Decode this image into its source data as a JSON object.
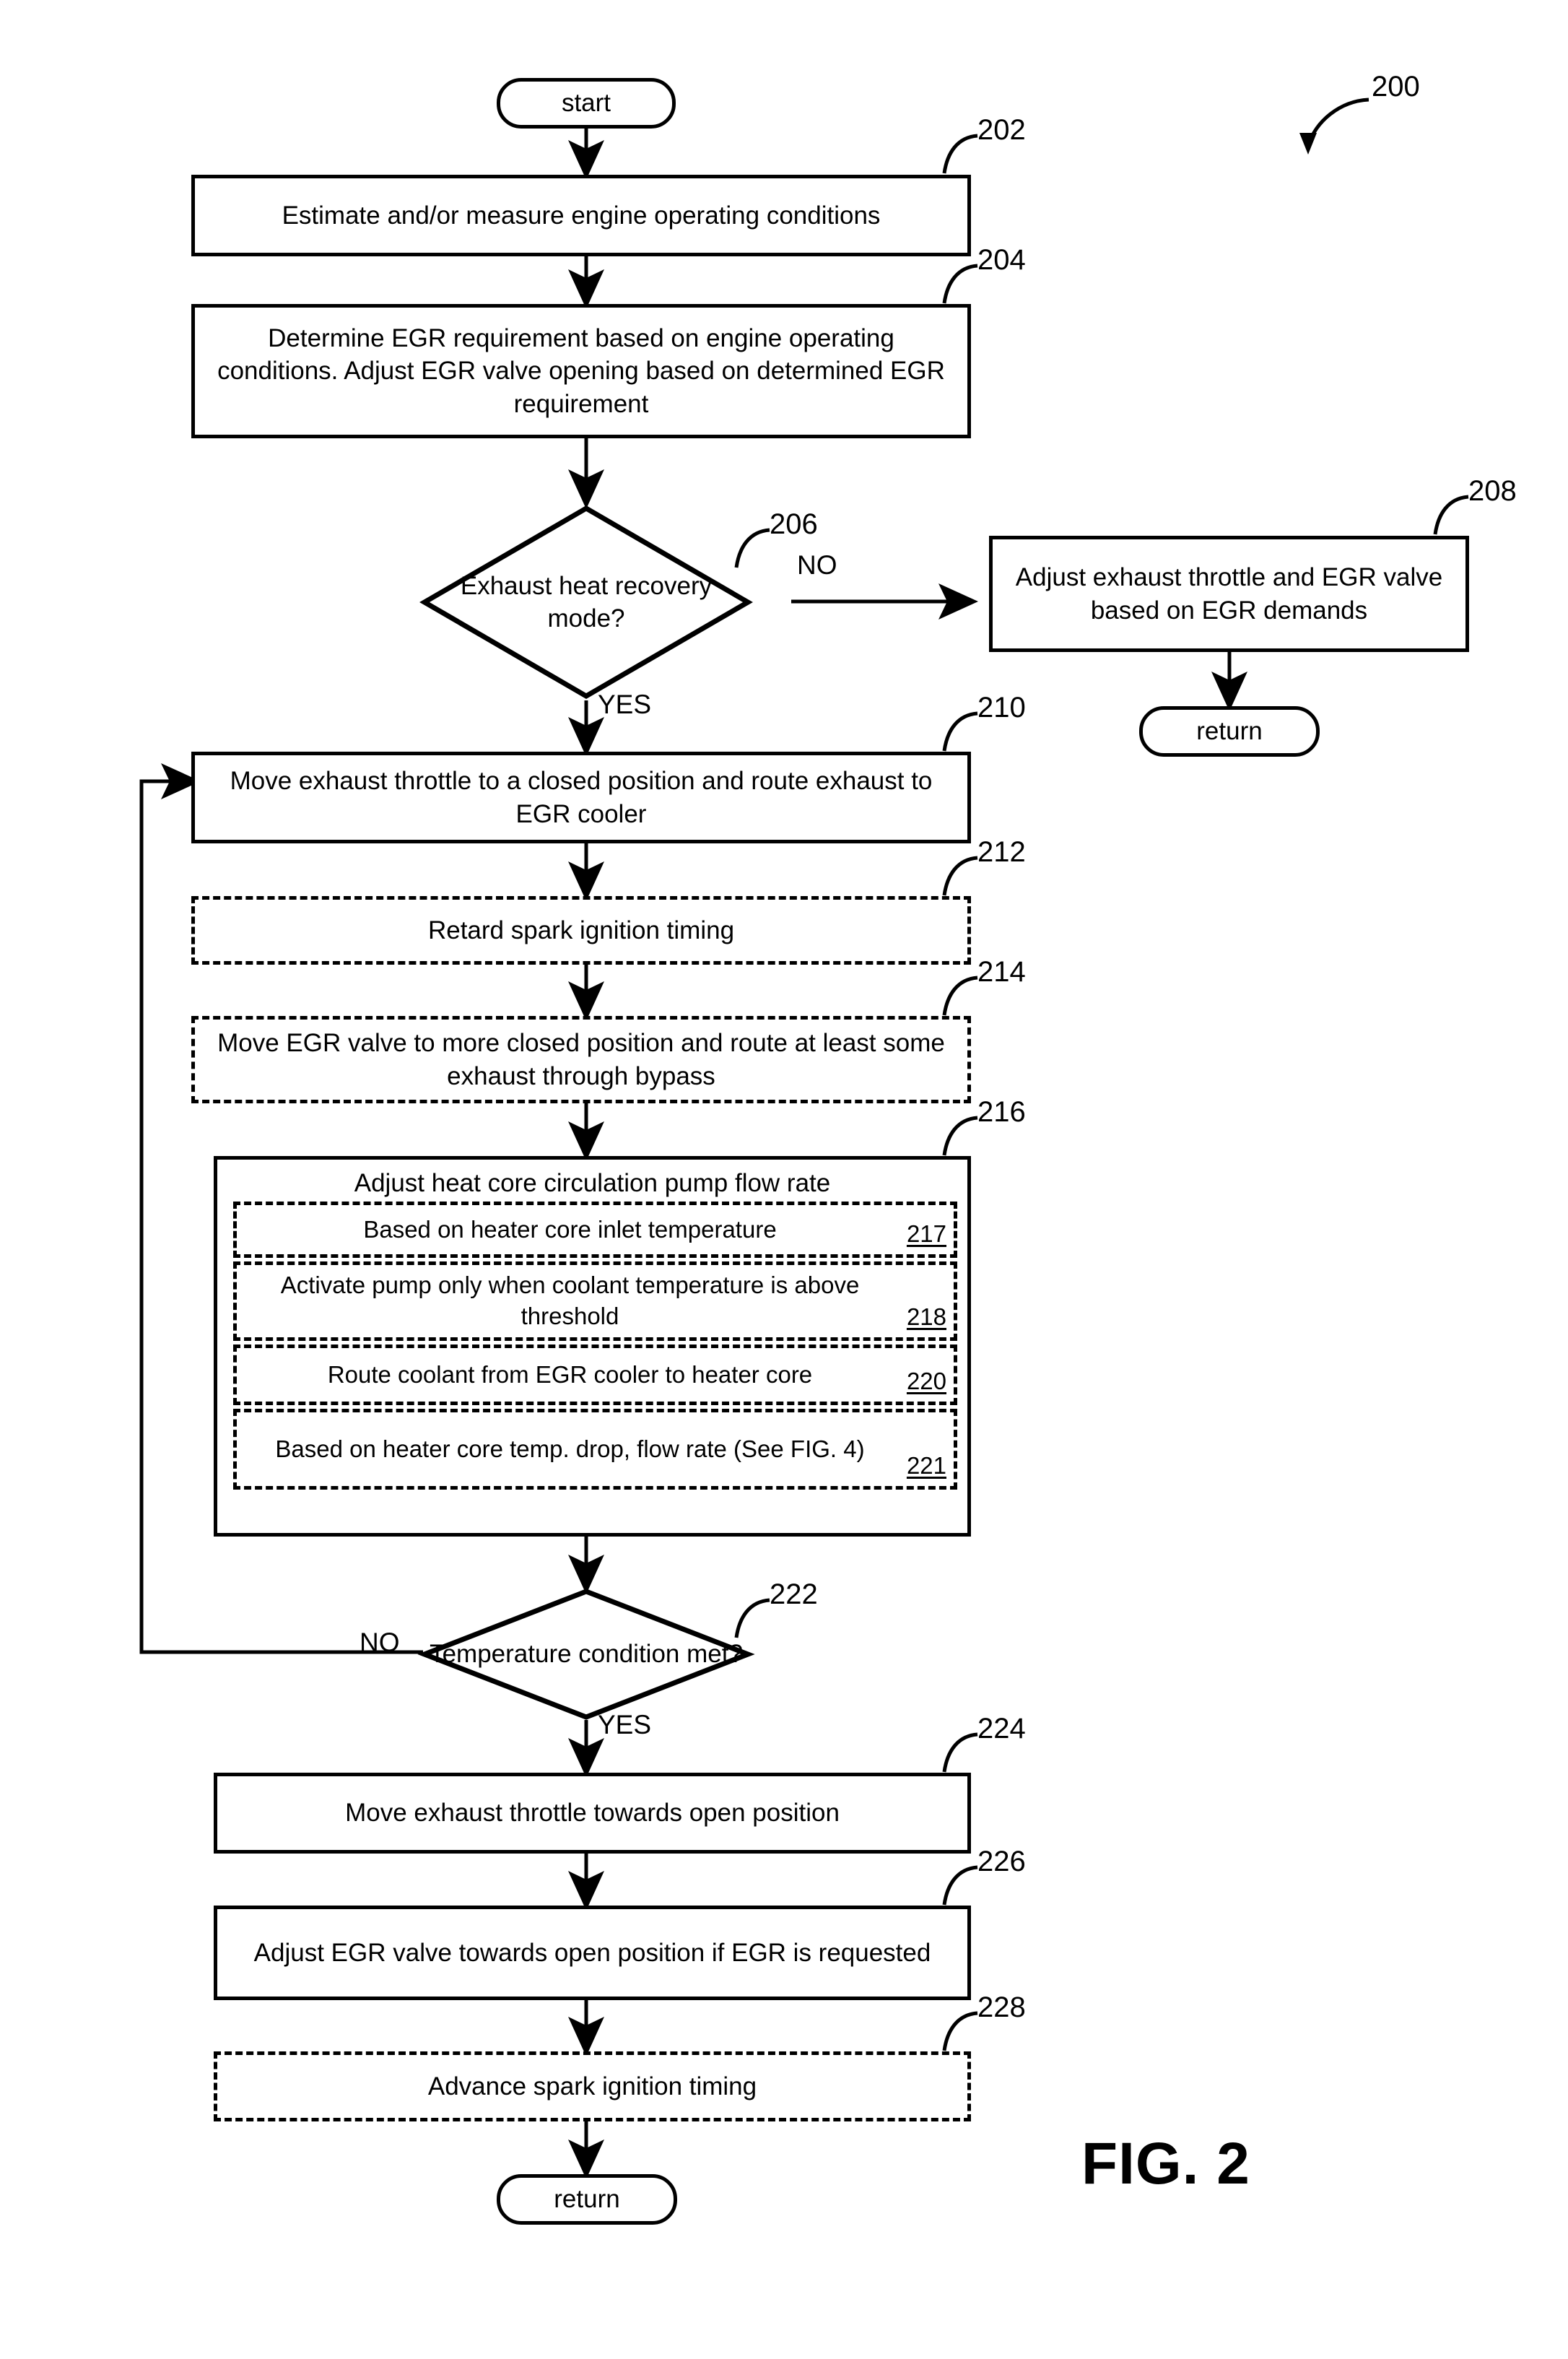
{
  "figure": {
    "caption": "FIG. 2",
    "method_ref": "200"
  },
  "terminators": {
    "start": "start",
    "return_branch": "return",
    "return_end": "return"
  },
  "edge_labels": {
    "d206_no": "NO",
    "d206_yes": "YES",
    "d222_no": "NO",
    "d222_yes": "YES"
  },
  "steps": [
    {
      "ref": "202",
      "style": "solid",
      "text": "Estimate and/or measure engine operating conditions"
    },
    {
      "ref": "204",
      "style": "solid",
      "text": "Determine EGR requirement based on engine operating conditions. Adjust EGR valve opening based on determined EGR requirement"
    },
    {
      "ref": "206",
      "style": "decision",
      "text": "Exhaust heat recovery mode?"
    },
    {
      "ref": "208",
      "style": "solid",
      "text": "Adjust exhaust throttle and EGR valve based on EGR demands"
    },
    {
      "ref": "210",
      "style": "solid",
      "text": "Move exhaust throttle to a closed position and route exhaust to EGR cooler"
    },
    {
      "ref": "212",
      "style": "dashed",
      "text": "Retard spark ignition timing"
    },
    {
      "ref": "214",
      "style": "dashed",
      "text": "Move EGR valve to more closed position and route at least some exhaust through bypass"
    },
    {
      "ref": "216",
      "style": "solid",
      "text": "Adjust heat core circulation pump flow rate"
    },
    {
      "ref": "222",
      "style": "decision",
      "text": "Temperature condition met?"
    },
    {
      "ref": "224",
      "style": "solid",
      "text": "Move exhaust throttle towards open position"
    },
    {
      "ref": "226",
      "style": "solid",
      "text": "Adjust EGR valve towards open position if EGR is requested"
    },
    {
      "ref": "228",
      "style": "dashed",
      "text": "Advance spark ignition timing"
    }
  ],
  "substeps_216": [
    {
      "ref": "217",
      "text": "Based on heater core inlet temperature"
    },
    {
      "ref": "218",
      "text": "Activate pump only when coolant temperature is above threshold"
    },
    {
      "ref": "220",
      "text": "Route coolant from EGR cooler to heater core"
    },
    {
      "ref": "221",
      "text": "Based on heater core temp. drop, flow rate (See FIG. 4)"
    }
  ]
}
